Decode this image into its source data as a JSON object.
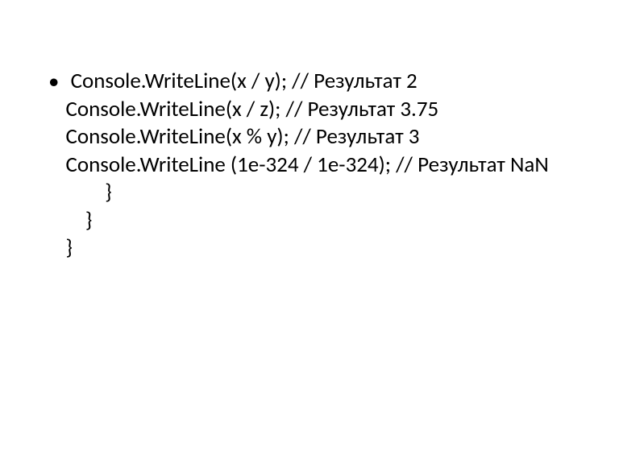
{
  "bullet": {
    "marker": "•",
    "lines": [
      " Console.WriteLine(x / y); // Результат 2",
      "Console.WriteLine(x / z); // Результат 3.75",
      "Console.WriteLine(x % y); // Результат 3",
      "Console.WriteLine (1e-324 / 1e-324); // Результат NaN",
      "        }",
      "    }",
      "}"
    ]
  }
}
